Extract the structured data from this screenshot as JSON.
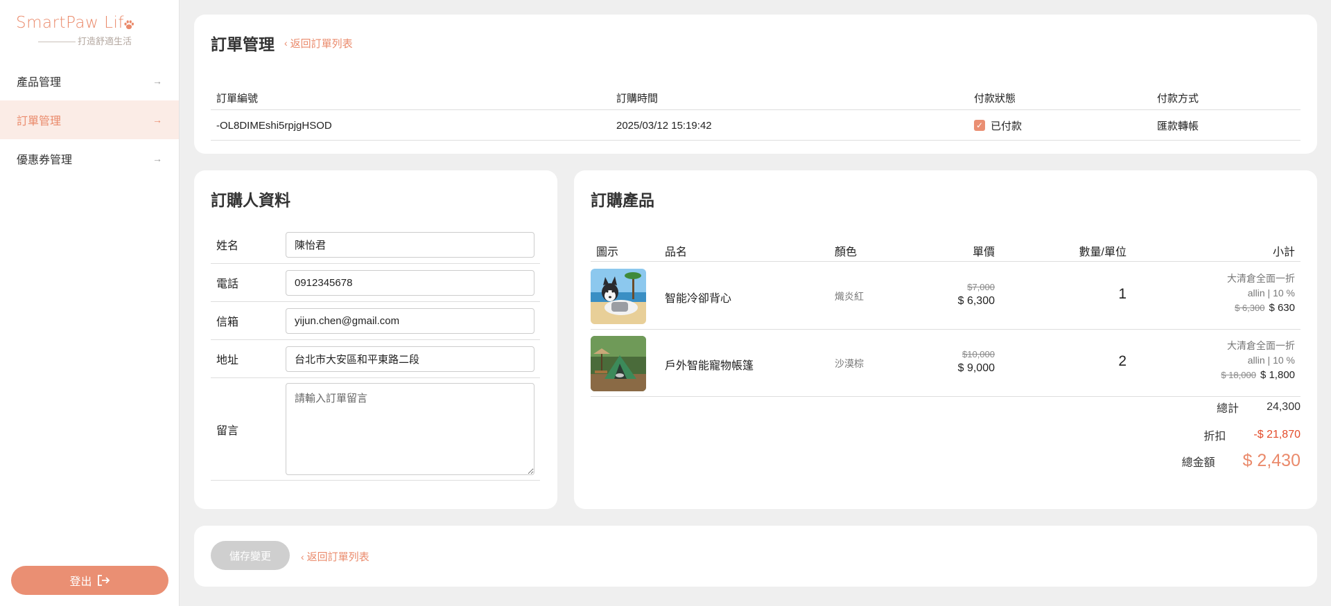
{
  "brand": {
    "name": "SmartPaw Lif",
    "tagline": "打造舒適生活"
  },
  "sidebar": {
    "items": [
      {
        "label": "產品管理"
      },
      {
        "label": "訂單管理"
      },
      {
        "label": "優惠券管理"
      }
    ],
    "logout_label": "登出"
  },
  "order_header": {
    "title": "訂單管理",
    "back_label": "返回訂單列表",
    "columns": [
      "訂單編號",
      "訂購時間",
      "付款狀態",
      "付款方式"
    ],
    "order_id": "-OL8DIMEshi5rpjgHSOD",
    "order_time": "2025/03/12 15:19:42",
    "payment_status": "已付款",
    "payment_method": "匯款轉帳"
  },
  "buyer": {
    "title": "訂購人資料",
    "fields": [
      {
        "label": "姓名",
        "value": "陳怡君"
      },
      {
        "label": "電話",
        "value": "0912345678"
      },
      {
        "label": "信箱",
        "value": "yijun.chen@gmail.com"
      },
      {
        "label": "地址",
        "value": "台北市大安區和平東路二段"
      }
    ],
    "note_label": "留言",
    "note_placeholder": "請輸入訂單留言",
    "note_value": ""
  },
  "products": {
    "title": "訂購產品",
    "columns": [
      "圖示",
      "品名",
      "顏色",
      "單價",
      "數量/單位",
      "小計"
    ],
    "rows": [
      {
        "name": "智能冷卻背心",
        "color": "熾炎紅",
        "original_price": "$7,000",
        "price": "$ 6,300",
        "qty": "1",
        "promo": "大清倉全面一折",
        "coupon": "allin | 10 %",
        "subtotal_original": "$ 6,300",
        "subtotal": "$ 630"
      },
      {
        "name": "戶外智能寵物帳篷",
        "color": "沙漠棕",
        "original_price": "$10,000",
        "price": "$ 9,000",
        "qty": "2",
        "promo": "大清倉全面一折",
        "coupon": "allin | 10 %",
        "subtotal_original": "$ 18,000",
        "subtotal": "$ 1,800"
      }
    ],
    "summary": {
      "total_label": "總計",
      "total": "24,300",
      "discount_label": "折扣",
      "discount": "-$ 21,870",
      "grand_label": "總金額",
      "grand": "$ 2,430"
    }
  },
  "footer": {
    "save_label": "儲存變更",
    "back_label": "返回訂單列表"
  },
  "colors": {
    "accent": "#ea8a6b",
    "discount": "#e34b2a",
    "disabled": "#cfcfcf",
    "background": "#efefef"
  }
}
